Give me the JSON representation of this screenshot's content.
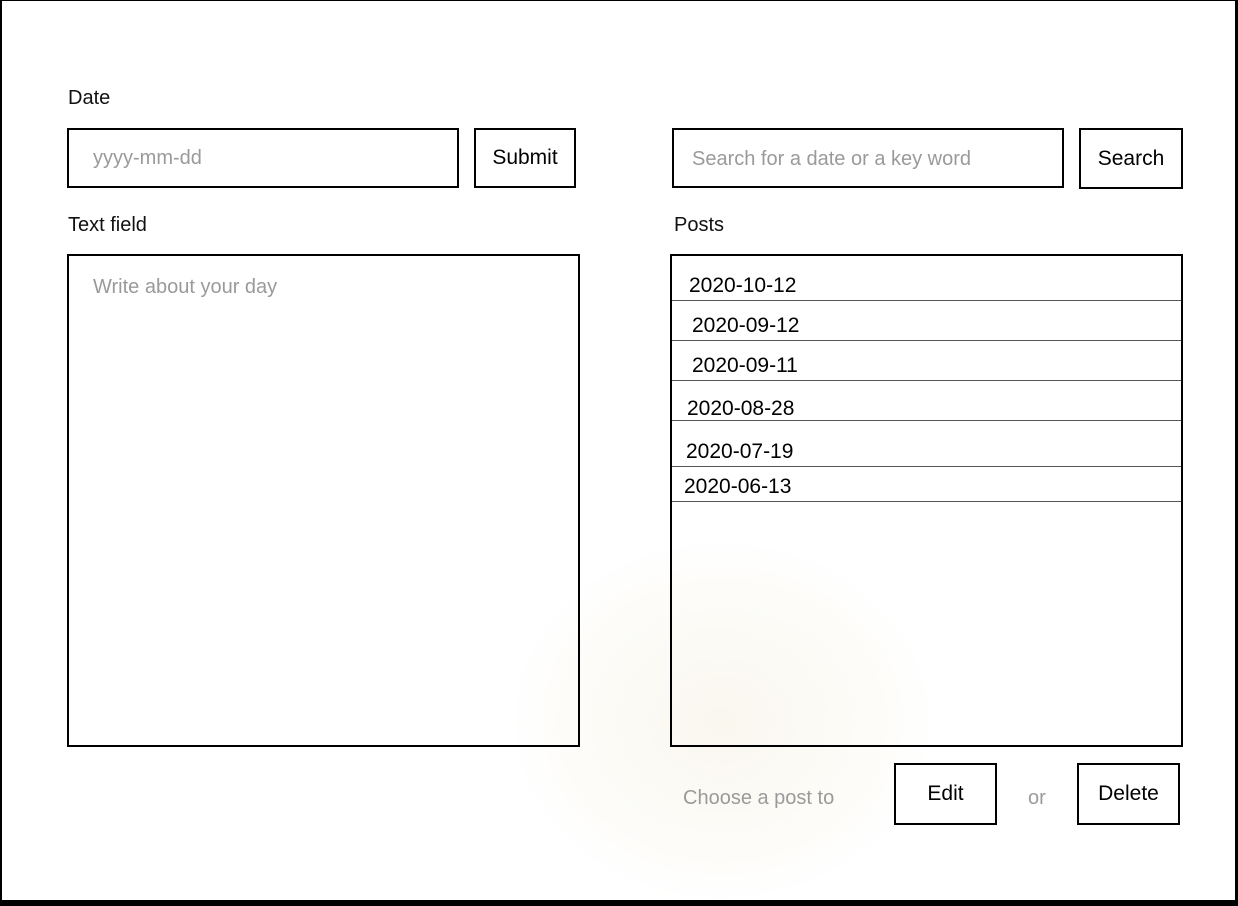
{
  "left": {
    "date_label": "Date",
    "date_input": {
      "placeholder": "yyyy-mm-dd",
      "value": ""
    },
    "submit_label": "Submit",
    "text_label": "Text field",
    "text_area": {
      "placeholder": "Write about your day",
      "value": ""
    }
  },
  "right": {
    "search_input": {
      "placeholder": "Search for a date or a key word",
      "value": ""
    },
    "search_label": "Search",
    "posts_label": "Posts",
    "posts": [
      "2020-10-12",
      "2020-09-12",
      "2020-09-11",
      "2020-08-28",
      "2020-07-19",
      "2020-06-13"
    ],
    "action_prompt": "Choose a post to",
    "edit_label": "Edit",
    "or_text": "or",
    "delete_label": "Delete"
  }
}
